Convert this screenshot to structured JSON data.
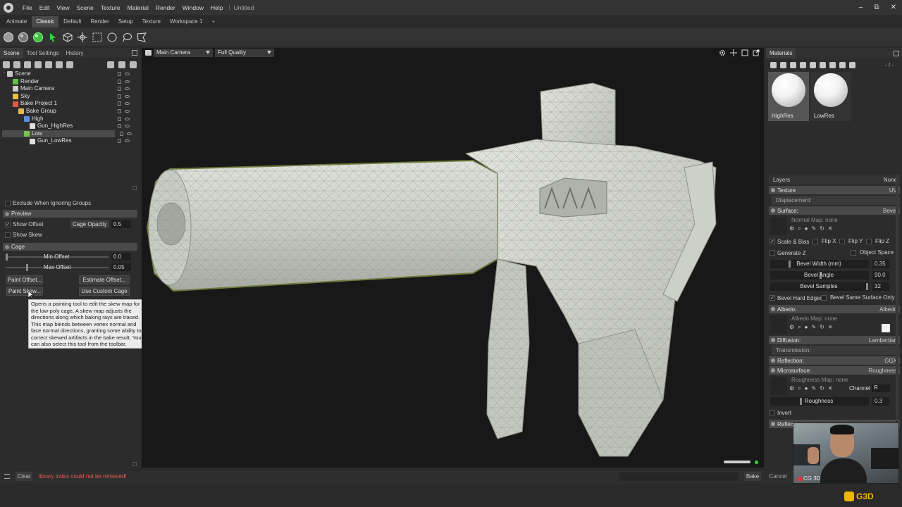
{
  "menubar": {
    "items": [
      "File",
      "Edit",
      "View",
      "Scene",
      "Texture",
      "Material",
      "Render",
      "Window",
      "Help"
    ],
    "separator": "|",
    "doc_title": "Untitled",
    "window_controls": {
      "minimize": "–",
      "restore": "⧉",
      "close": "✕"
    }
  },
  "workspace_tabs": [
    "Animate",
    "Classic",
    "Default",
    "Render",
    "Setup",
    "Texture",
    "Workspace 1",
    "+"
  ],
  "workspace_active": "Classic",
  "left_panel": {
    "tabs": [
      "Scene",
      "Tool Settings",
      "History"
    ],
    "tree": [
      {
        "label": "Scene",
        "depth": 0,
        "color": "#c8c8c8"
      },
      {
        "label": "Render",
        "depth": 1,
        "color": "#5fbf4a"
      },
      {
        "label": "Main Camera",
        "depth": 1,
        "color": "#cccccc"
      },
      {
        "label": "Sky",
        "depth": 1,
        "color": "#e7c24a"
      },
      {
        "label": "Bake Project 1",
        "depth": 1,
        "color": "#e05a4a"
      },
      {
        "label": "Bake Group",
        "depth": 2,
        "color": "#e7b64a"
      },
      {
        "label": "High",
        "depth": 3,
        "color": "#5a8fe0"
      },
      {
        "label": "Gun_HighRes",
        "depth": 4,
        "color": "#dddddd"
      },
      {
        "label": "Low",
        "depth": 3,
        "color": "#79c24e",
        "selected": true
      },
      {
        "label": "Gun_LowRes",
        "depth": 4,
        "color": "#dddddd"
      }
    ],
    "exclude_label": "Exclude When Ignoring Groups",
    "preview_header": "Preview",
    "show_offset": "Show Offset",
    "show_offset_check": "✓",
    "cage_opacity_label": "Cage Opacity",
    "cage_opacity_value": "0.5",
    "show_skew": "Show Skew",
    "cage_header": "Cage",
    "min_offset_label": "Min Offset",
    "min_offset_value": "0.0",
    "min_offset_level": 0.0,
    "max_offset_label": "Max Offset",
    "max_offset_value": "0.05",
    "max_offset_level": 0.2,
    "paint_offset": "Paint Offset...",
    "estimate_offset": "Estimate Offset...",
    "paint_skew": "Paint Skew...",
    "use_custom_cage": "Use Custom Cage",
    "tooltip": "Opens a painting tool to edit the skew map for the low-poly cage. A skew map adjusts the directions along which baking rays are traced. This map blends between vertex normal and face normal directions, granting some ability to correct skewed artifacts in the bake result. You can also select this tool from the toolbar."
  },
  "viewport": {
    "camera": "Main Camera",
    "quality": "Full Quality"
  },
  "right_panel": {
    "title": "Materials",
    "path": "- / -",
    "materials": [
      {
        "name": "HighRes",
        "selected": true
      },
      {
        "name": "LowRes",
        "selected": false
      }
    ],
    "layers_label": "Layers",
    "layers_value": "None",
    "texture_label": "Texture",
    "texture_value": "UV",
    "displacement_label": "Displacement:",
    "displacement_value": "-",
    "surface_label": "Surface:",
    "surface_value": "Bevel",
    "normal_map": "Normal Map: none",
    "scale_bias": "Scale & Bias",
    "flip_x": "Flip X",
    "flip_y": "Flip Y",
    "flip_z": "Flip Z",
    "generate_z": "Generate Z",
    "object_space": "Object Space",
    "bevel_width_label": "Bevel Width (mm)",
    "bevel_width_value": "0.35",
    "bevel_angle_label": "Bevel Angle",
    "bevel_angle_value": "90.0",
    "bevel_samples_label": "Bevel Samples",
    "bevel_samples_value": "32",
    "bevel_hard_edges": "Bevel Hard Edges",
    "bevel_same_surface": "Bevel Same Surface Only",
    "albedo_label": "Albedo:",
    "albedo_value": "Albedo",
    "albedo_map": "Albedo Map: none",
    "diffusion_label": "Diffusion:",
    "diffusion_value": "Lambertian",
    "transmission_label": "Transmission:",
    "transmission_value": "-",
    "reflection_label": "Reflection:",
    "reflection_value": "GGX",
    "microsurface_label": "Microsurface:",
    "microsurface_value": "Roughness",
    "roughness_map": "Roughness Map: none",
    "channel_label": "Channel",
    "channel_value": "R",
    "roughness_label": "Roughness",
    "roughness_value": "0.3",
    "invert_label": "Invert",
    "reflect_partial": "Reflec"
  },
  "status": {
    "clear": "Clear",
    "message": "library index could not be retrieved!",
    "bake": "Bake",
    "cancel": "Cancel"
  },
  "webcam_watermark": "CG 3D",
  "brand": "G3D",
  "colors": {
    "accent_green": "#3ad43a",
    "error_red": "#e65a4f",
    "brand_yellow": "#f0b400",
    "viewport_bg": "#181818"
  }
}
